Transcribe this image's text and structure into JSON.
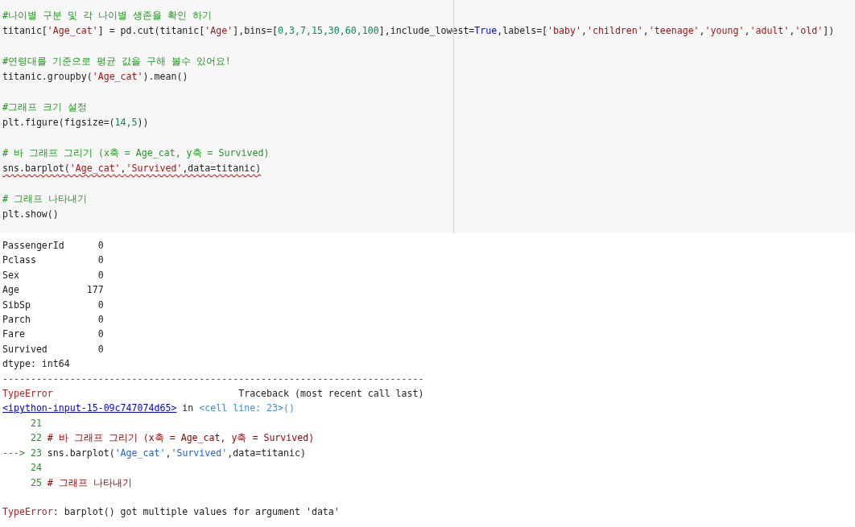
{
  "code_cell": {
    "blocks": [
      {
        "lines": [
          {
            "tokens": [
              {
                "kind": "comment",
                "text": "#나이별 구분 및 각 나이별 생존율 확인 하기"
              }
            ]
          },
          {
            "tokens": [
              {
                "kind": "plain",
                "text": "titanic["
              },
              {
                "kind": "string",
                "text": "'Age_cat'"
              },
              {
                "kind": "plain",
                "text": "] = pd.cut(titanic["
              },
              {
                "kind": "string",
                "text": "'Age'"
              },
              {
                "kind": "plain",
                "text": "],bins=["
              },
              {
                "kind": "number",
                "text": "0,3,7,15,30,60,100"
              },
              {
                "kind": "plain",
                "text": "],include_lowest="
              },
              {
                "kind": "keyword",
                "text": "True"
              },
              {
                "kind": "plain",
                "text": ",labels=["
              },
              {
                "kind": "string",
                "text": "'baby'"
              },
              {
                "kind": "plain",
                "text": ","
              },
              {
                "kind": "string",
                "text": "'children'"
              },
              {
                "kind": "plain",
                "text": ","
              },
              {
                "kind": "string",
                "text": "'teenage'"
              },
              {
                "kind": "plain",
                "text": ","
              },
              {
                "kind": "string",
                "text": "'young'"
              },
              {
                "kind": "plain",
                "text": ","
              },
              {
                "kind": "string",
                "text": "'adult'"
              },
              {
                "kind": "plain",
                "text": ","
              },
              {
                "kind": "string",
                "text": "'old'"
              },
              {
                "kind": "plain",
                "text": "])"
              }
            ]
          }
        ]
      },
      {
        "lines": [
          {
            "tokens": [
              {
                "kind": "comment",
                "text": "#연령대를 기준으로 평균 값을 구해 볼수 있어요!"
              }
            ]
          },
          {
            "tokens": [
              {
                "kind": "plain",
                "text": "titanic.groupby("
              },
              {
                "kind": "string",
                "text": "'Age_cat'"
              },
              {
                "kind": "plain",
                "text": ").mean()"
              }
            ]
          }
        ]
      },
      {
        "lines": [
          {
            "tokens": [
              {
                "kind": "comment",
                "text": "#그래프 크기 설정"
              }
            ]
          },
          {
            "tokens": [
              {
                "kind": "plain",
                "text": "plt.figure(figsize=("
              },
              {
                "kind": "number",
                "text": "14,5"
              },
              {
                "kind": "plain",
                "text": "))"
              }
            ]
          }
        ]
      },
      {
        "lines": [
          {
            "tokens": [
              {
                "kind": "comment",
                "text": "# 바 그래프 그리기 (x축 = Age_cat, y축 = Survived)"
              }
            ]
          },
          {
            "error_underline": true,
            "tokens": [
              {
                "kind": "plain",
                "text": "sns.barplot("
              },
              {
                "kind": "string",
                "text": "'Age_cat'"
              },
              {
                "kind": "plain",
                "text": ","
              },
              {
                "kind": "string",
                "text": "'Survived'"
              },
              {
                "kind": "plain",
                "text": ",data=titanic)"
              }
            ]
          }
        ]
      },
      {
        "lines": [
          {
            "tokens": [
              {
                "kind": "comment",
                "text": "# 그래프 나타내기"
              }
            ]
          },
          {
            "tokens": [
              {
                "kind": "plain",
                "text": "plt.show()"
              }
            ]
          }
        ]
      }
    ]
  },
  "output": {
    "blocks": [
      {
        "lines": [
          {
            "tokens": [
              {
                "kind": "plain",
                "text": "PassengerId      0"
              }
            ]
          },
          {
            "tokens": [
              {
                "kind": "plain",
                "text": "Pclass           0"
              }
            ]
          },
          {
            "tokens": [
              {
                "kind": "plain",
                "text": "Sex              0"
              }
            ]
          },
          {
            "tokens": [
              {
                "kind": "plain",
                "text": "Age            177"
              }
            ]
          },
          {
            "tokens": [
              {
                "kind": "plain",
                "text": "SibSp            0"
              }
            ]
          },
          {
            "tokens": [
              {
                "kind": "plain",
                "text": "Parch            0"
              }
            ]
          },
          {
            "tokens": [
              {
                "kind": "plain",
                "text": "Fare             0"
              }
            ]
          },
          {
            "tokens": [
              {
                "kind": "plain",
                "text": "Survived         0"
              }
            ]
          },
          {
            "tokens": [
              {
                "kind": "plain",
                "text": "dtype: int64"
              }
            ]
          },
          {
            "tokens": [
              {
                "kind": "error",
                "text": "---------------------------------------------------------------------------"
              }
            ]
          },
          {
            "tokens": [
              {
                "kind": "error",
                "text": "TypeError"
              },
              {
                "kind": "plain",
                "text": "                                 Traceback (most recent call last)"
              }
            ]
          },
          {
            "tokens": [
              {
                "kind": "link",
                "text": "<ipython-input-15-09c747074d65>"
              },
              {
                "kind": "plain",
                "text": " in "
              },
              {
                "kind": "cellref",
                "text": "<cell line: 23>()"
              }
            ]
          },
          {
            "tokens": [
              {
                "kind": "lineno",
                "text": "     21"
              }
            ]
          },
          {
            "tokens": [
              {
                "kind": "lineno",
                "text": "     22"
              },
              {
                "kind": "tb_comment",
                "text": " # 바 그래프 그리기 (x축 = Age_cat, y축 = Survived)"
              }
            ]
          },
          {
            "tokens": [
              {
                "kind": "lineno",
                "text": "---> 23"
              },
              {
                "kind": "plain",
                "text": " sns.barplot("
              },
              {
                "kind": "tb_string",
                "text": "'Age_cat'"
              },
              {
                "kind": "plain",
                "text": ","
              },
              {
                "kind": "tb_string",
                "text": "'Survived'"
              },
              {
                "kind": "plain",
                "text": ",data=titanic)"
              }
            ]
          },
          {
            "tokens": [
              {
                "kind": "lineno",
                "text": "     24"
              }
            ]
          },
          {
            "tokens": [
              {
                "kind": "lineno",
                "text": "     25"
              },
              {
                "kind": "tb_comment",
                "text": " # 그래프 나타내기"
              }
            ]
          }
        ]
      },
      {
        "lines": [
          {
            "tokens": [
              {
                "kind": "error",
                "text": "TypeError"
              },
              {
                "kind": "plain",
                "text": ": barplot() got multiple values for argument 'data'"
              }
            ]
          }
        ]
      }
    ]
  }
}
